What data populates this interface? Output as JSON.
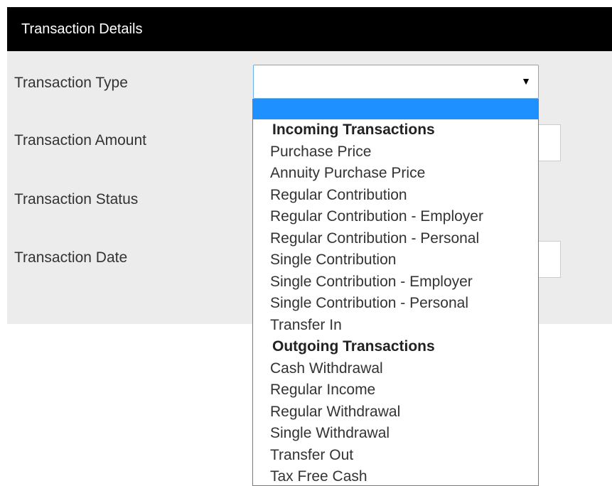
{
  "panel": {
    "title": "Transaction Details"
  },
  "fields": {
    "type_label": "Transaction Type",
    "amount_label": "Transaction Amount",
    "status_label": "Transaction Status",
    "date_label": "Transaction Date",
    "type_value": ""
  },
  "dropdown": {
    "groups": [
      {
        "label": "Incoming Transactions",
        "options": [
          "Purchase Price",
          "Annuity Purchase Price",
          "Regular Contribution",
          "Regular Contribution - Employer",
          "Regular Contribution - Personal",
          "Single Contribution",
          "Single Contribution - Employer",
          "Single Contribution - Personal",
          "Transfer In"
        ]
      },
      {
        "label": "Outgoing Transactions",
        "options": [
          "Cash Withdrawal",
          "Regular Income",
          "Regular Withdrawal",
          "Single Withdrawal",
          "Transfer Out",
          "Tax Free Cash"
        ]
      }
    ]
  },
  "colors": {
    "header_bg": "#000000",
    "panel_bg": "#ececec",
    "highlight": "#1e90ff",
    "focus_border": "#66afe9"
  }
}
